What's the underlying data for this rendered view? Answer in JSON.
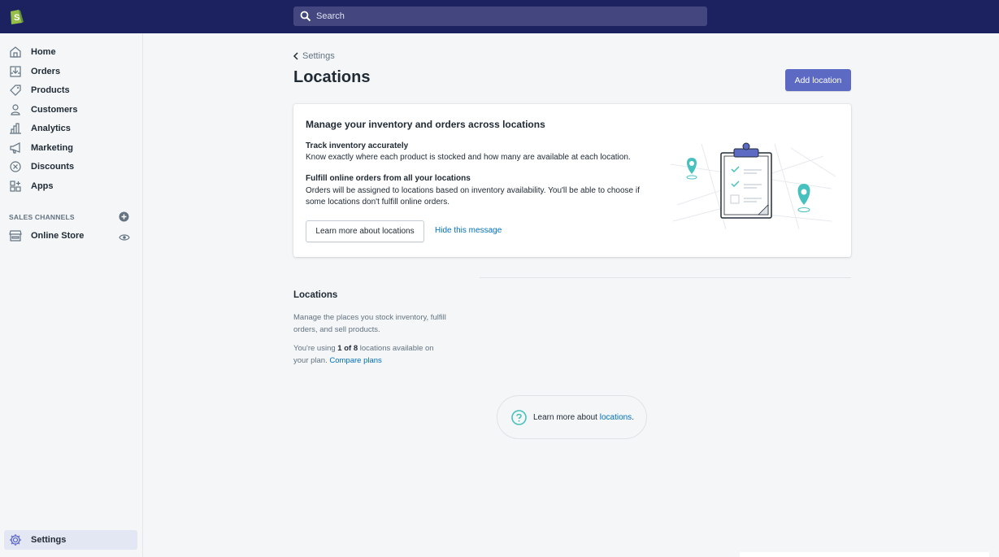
{
  "topbar": {
    "search_placeholder": "Search",
    "bg_color": "#1c2260"
  },
  "sidebar": {
    "items": [
      {
        "label": "Home",
        "icon": "home-icon"
      },
      {
        "label": "Orders",
        "icon": "orders-icon"
      },
      {
        "label": "Products",
        "icon": "tag-icon"
      },
      {
        "label": "Customers",
        "icon": "person-icon"
      },
      {
        "label": "Analytics",
        "icon": "bar-chart-icon"
      },
      {
        "label": "Marketing",
        "icon": "megaphone-icon"
      },
      {
        "label": "Discounts",
        "icon": "discount-icon"
      },
      {
        "label": "Apps",
        "icon": "apps-icon"
      }
    ],
    "sales_channels_label": "SALES CHANNELS",
    "online_store_label": "Online Store",
    "settings_label": "Settings"
  },
  "header": {
    "breadcrumb": "Settings",
    "title": "Locations",
    "add_button": "Add location"
  },
  "card": {
    "title": "Manage your inventory and orders across locations",
    "heading1": "Track inventory accurately",
    "text1": "Know exactly where each product is stocked and how many are available at each location.",
    "heading2": "Fulfill online orders from all your locations",
    "text2": "Orders will be assigned to locations based on inventory availability. You'll be able to choose if some locations don't fulfill online orders.",
    "learn_button": "Learn more about locations",
    "hide_link": "Hide this message"
  },
  "locations_section": {
    "title": "Locations",
    "description": "Manage the places you stock inventory, fulfill orders, and sell products.",
    "usage_prefix": "You're using ",
    "usage_count": "1 of 8",
    "usage_suffix": " locations available on your plan. ",
    "compare_link": "Compare plans"
  },
  "help": {
    "text": "Learn more about ",
    "link": "locations",
    "suffix": "."
  },
  "colors": {
    "accent": "#5c6ac4",
    "link": "#006fbb",
    "teal": "#47c1bf"
  }
}
